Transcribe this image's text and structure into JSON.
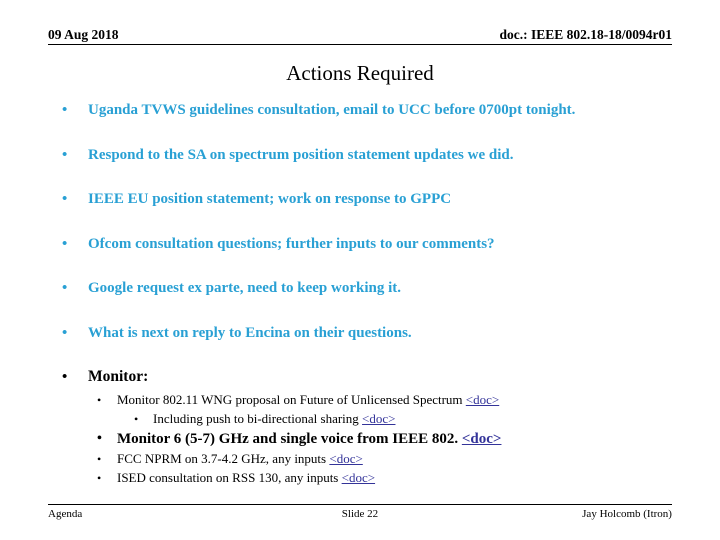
{
  "header": {
    "date": "09 Aug 2018",
    "doc": "doc.: IEEE 802.18-18/0094r01"
  },
  "title": "Actions Required",
  "colors": {
    "bullet_accent": "#29A0D4",
    "link": "#333399",
    "text": "#000000",
    "background": "#ffffff"
  },
  "bullet_glyph": "•",
  "bullets": [
    {
      "level": 1,
      "style": "accent",
      "text": "Uganda TVWS guidelines consultation, email to UCC before 0700pt tonight."
    },
    {
      "level": 1,
      "style": "accent",
      "text": "Respond to the SA on spectrum position statement updates we did."
    },
    {
      "level": 1,
      "style": "accent",
      "text": "IEEE EU position statement; work on response to GPPC"
    },
    {
      "level": 1,
      "style": "accent",
      "text": "Ofcom consultation questions; further inputs to our comments?"
    },
    {
      "level": 1,
      "style": "accent",
      "text": "Google request ex parte, need to keep working it."
    },
    {
      "level": 1,
      "style": "accent",
      "text": "What is next on reply to Encina on their questions."
    },
    {
      "level": 1,
      "style": "black-bold",
      "text": "Monitor:"
    },
    {
      "level": 2,
      "style": "regular",
      "text": "Monitor 802.11 WNG proposal on Future of Unlicensed Spectrum ",
      "link": "<doc>"
    },
    {
      "level": 3,
      "style": "regular",
      "text": "Including push to bi-directional sharing ",
      "link": "<doc>"
    },
    {
      "level": 2,
      "style": "bold",
      "text": "Monitor 6 (5-7) GHz and single voice from IEEE 802. ",
      "link": "<doc>"
    },
    {
      "level": 2,
      "style": "regular",
      "text": "FCC NPRM on 3.7-4.2 GHz, any inputs ",
      "link": "<doc>"
    },
    {
      "level": 2,
      "style": "regular",
      "text": "ISED consultation on RSS 130, any inputs ",
      "link": "<doc>"
    }
  ],
  "footer": {
    "left": "Agenda",
    "center": "Slide 22",
    "right": "Jay Holcomb (Itron)"
  }
}
